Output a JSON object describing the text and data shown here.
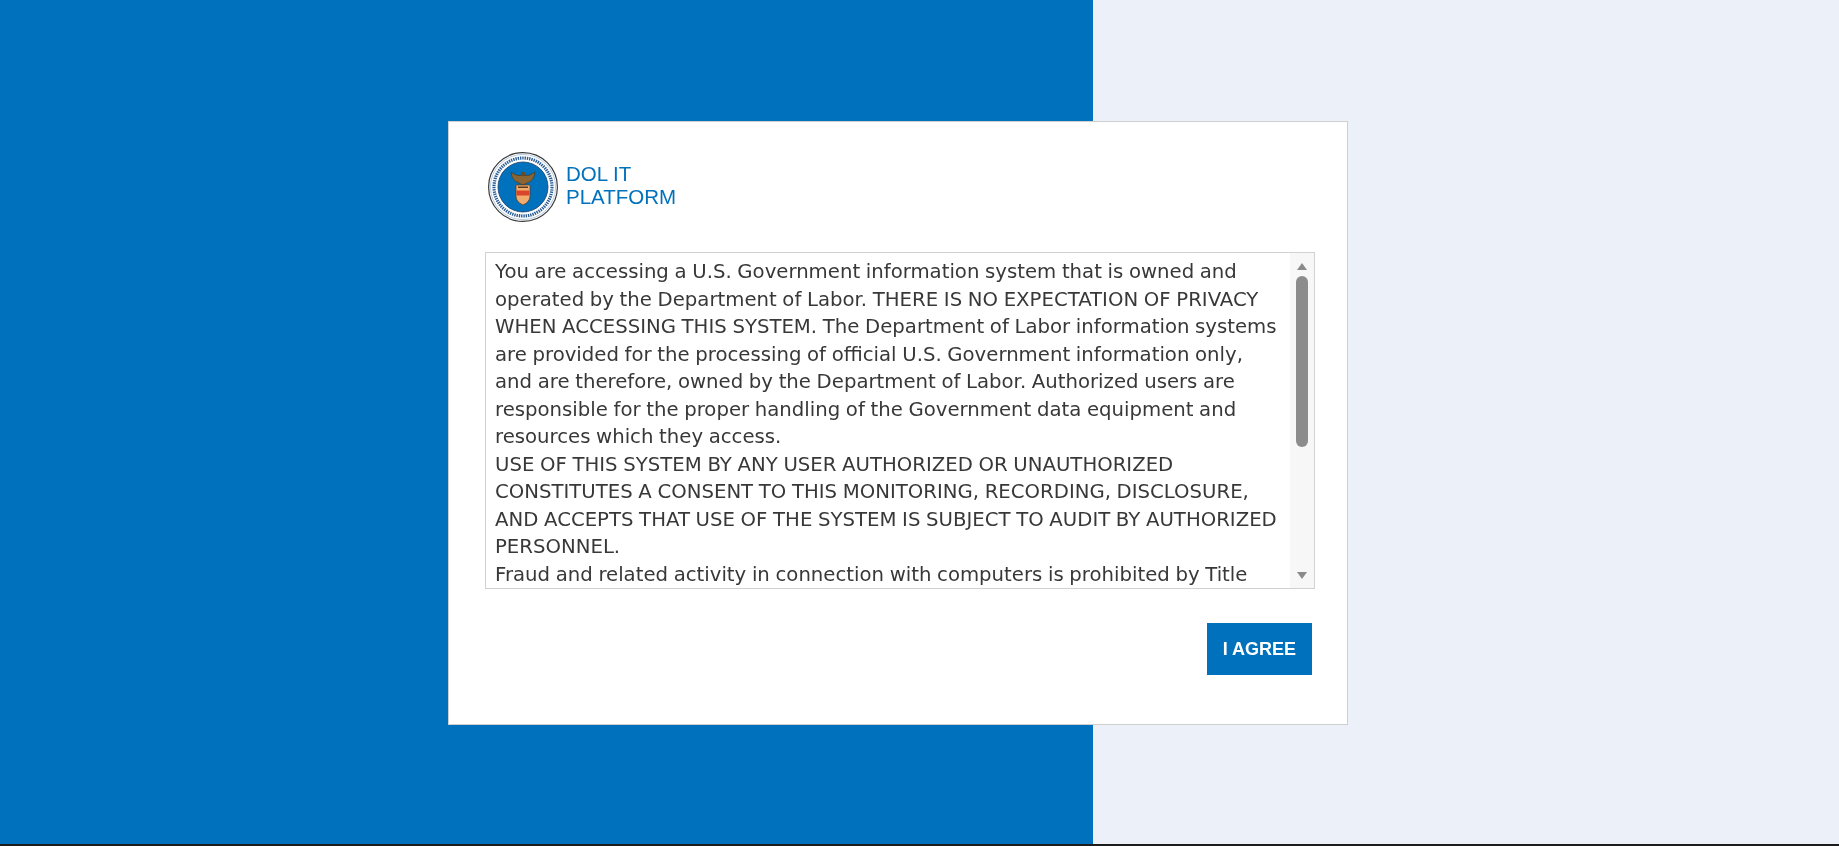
{
  "logo": {
    "title": "DOL IT PLATFORM"
  },
  "notice": {
    "paragraphs": [
      "You are accessing a U.S. Government information system that is owned and operated by the Department of Labor. THERE IS NO EXPECTATION OF PRIVACY WHEN ACCESSING THIS SYSTEM. The Department of Labor information systems are provided for the processing of official U.S. Government information only, and are therefore, owned by the Department of Labor. Authorized users are responsible for the proper handling of the Government data equipment and resources which they access.",
      "USE OF THIS SYSTEM BY ANY USER AUTHORIZED OR UNAUTHORIZED CONSTITUTES A CONSENT TO THIS MONITORING, RECORDING, DISCLOSURE, AND ACCEPTS THAT USE OF THE SYSTEM IS SUBJECT TO AUDIT BY AUTHORIZED PERSONNEL.",
      "Fraud and related activity in connection with computers is prohibited by Title"
    ]
  },
  "buttons": [
    {
      "label": "I AGREE"
    }
  ]
}
